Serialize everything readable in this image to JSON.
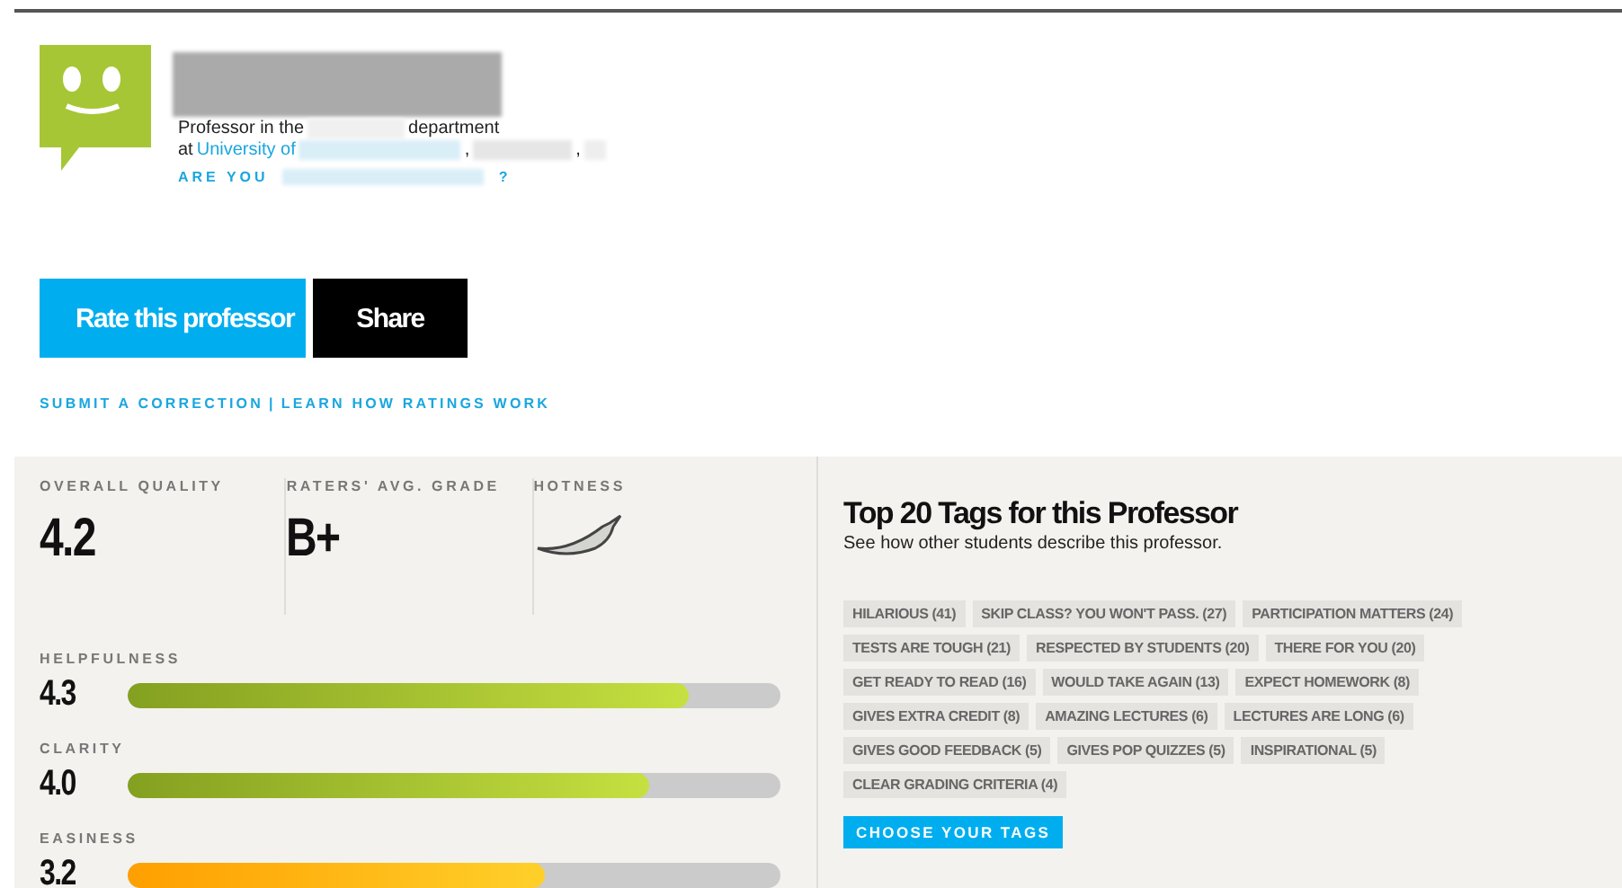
{
  "profile": {
    "line1_prefix": "Professor in the",
    "line1_suffix": "department",
    "line2_prefix": "at",
    "university_prefix": "University of",
    "separators": [
      ",",
      ","
    ],
    "claim_prefix": "ARE YOU",
    "claim_suffix": "?"
  },
  "buttons": [
    {
      "label": "Rate this professor",
      "kind": "primary"
    },
    {
      "label": "Share",
      "kind": "dark"
    }
  ],
  "links": [
    "SUBMIT A CORRECTION",
    "LEARN HOW RATINGS WORK"
  ],
  "link_separator": "|",
  "summary": [
    {
      "label": "OVERALL QUALITY",
      "value": "4.2"
    },
    {
      "label": "RATERS' AVG. GRADE",
      "value": "B+"
    }
  ],
  "hotness": {
    "label": "HOTNESS",
    "hot": false
  },
  "ratings": [
    {
      "label": "HELPFULNESS",
      "value": "4.3",
      "level": 0.86,
      "kind": "good"
    },
    {
      "label": "CLARITY",
      "value": "4.0",
      "level": 0.8,
      "kind": "good"
    },
    {
      "label": "EASINESS",
      "value": "3.2",
      "level": 0.64,
      "kind": "average"
    }
  ],
  "tags_panel": {
    "title": "Top 20 Tags for this Professor",
    "subtitle": "See how other students describe this professor.",
    "button": "CHOOSE YOUR TAGS",
    "tags": [
      "HILARIOUS (41)",
      "SKIP CLASS? YOU WON'T PASS. (27)",
      "PARTICIPATION MATTERS (24)",
      "TESTS ARE TOUGH (21)",
      "RESPECTED BY STUDENTS (20)",
      "THERE FOR YOU (20)",
      "GET READY TO READ (16)",
      "WOULD TAKE AGAIN (13)",
      "EXPECT HOMEWORK (8)",
      "GIVES EXTRA CREDIT (8)",
      "AMAZING LECTURES (6)",
      "LECTURES ARE LONG (6)",
      "GIVES GOOD FEEDBACK (5)",
      "GIVES POP QUIZZES (5)",
      "INSPIRATIONAL (5)",
      "CLEAR GRADING CRITERIA (4)"
    ]
  }
}
